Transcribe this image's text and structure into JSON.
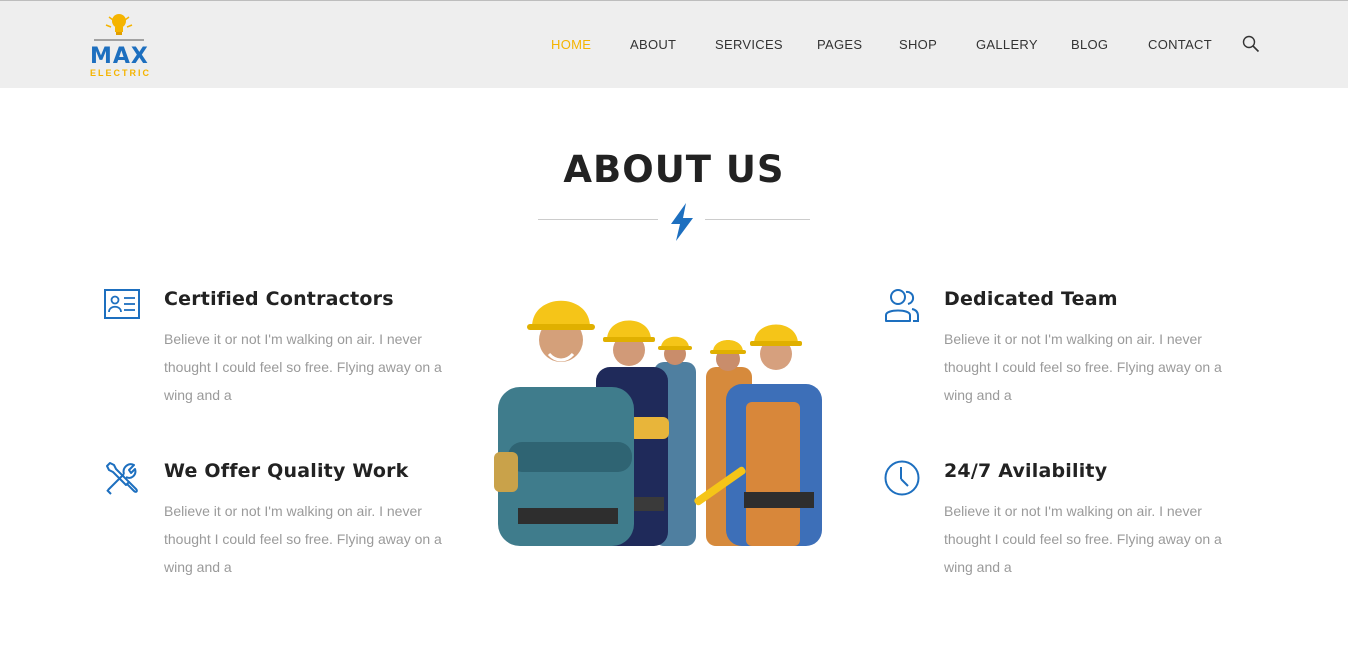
{
  "brand": {
    "name": "MAX",
    "tagline": "ELECTRIC"
  },
  "nav": {
    "items": [
      {
        "label": "HOME",
        "active": true
      },
      {
        "label": "ABOUT",
        "active": false
      },
      {
        "label": "SERVICES",
        "active": false
      },
      {
        "label": "PAGES",
        "active": false
      },
      {
        "label": "SHOP",
        "active": false
      },
      {
        "label": "GALLERY",
        "active": false
      },
      {
        "label": "BLOG",
        "active": false
      },
      {
        "label": "CONTACT",
        "active": false
      }
    ],
    "search_icon": "search-icon"
  },
  "about": {
    "title": "ABOUT US",
    "divider_icon": "lightning-bolt-icon",
    "features": [
      {
        "icon": "id-card-icon",
        "title": "Certified Contractors",
        "text": "Believe it or not I'm walking on air. I never thought I could feel so free. Flying away on a wing and a"
      },
      {
        "icon": "tools-icon",
        "title": "We Offer Quality Work",
        "text": "Believe it or not I'm walking on air. I never thought I could feel so free. Flying away on a wing and a"
      },
      {
        "icon": "team-icon",
        "title": "Dedicated Team",
        "text": "Believe it or not I'm walking on air. I never thought I could feel so free. Flying away on a wing and a"
      },
      {
        "icon": "clock-icon",
        "title": "24/7 Avilability",
        "text": "Believe it or not I'm walking on air. I never thought I could feel so free. Flying away on a wing and a"
      }
    ],
    "image": "workers-group-photo"
  },
  "colors": {
    "accent": "#f5b400",
    "brand_blue": "#1d6fbf",
    "header_bg": "#eeeeee",
    "heading": "#222222",
    "body_text": "#9a9a9a"
  }
}
